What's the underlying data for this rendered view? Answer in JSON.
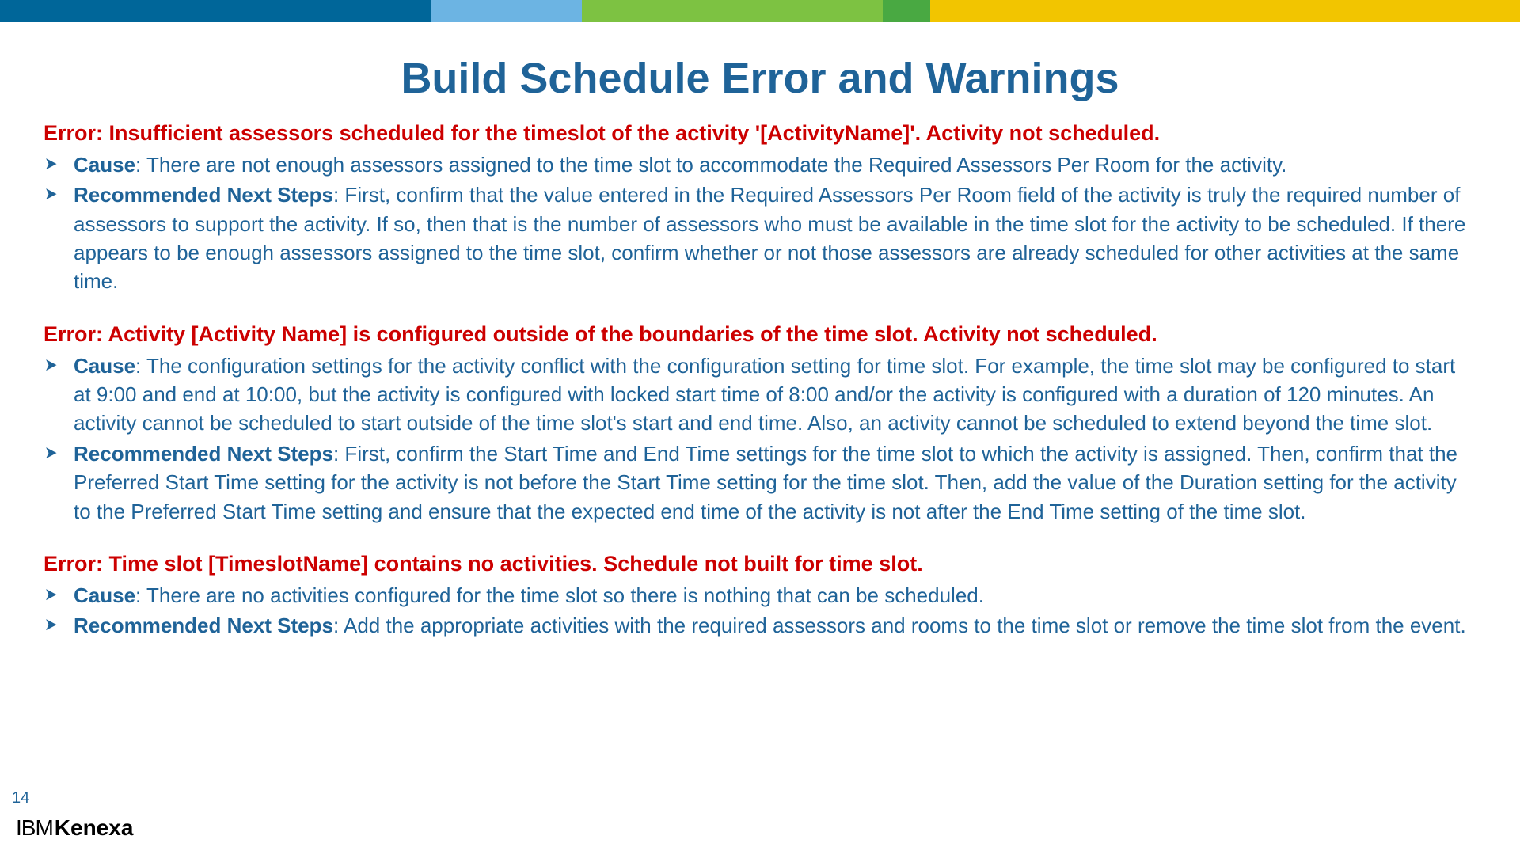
{
  "title": "Build Schedule Error and Warnings",
  "errors": [
    {
      "heading": "Error: Insufficient assessors scheduled for the timeslot of the activity '[ActivityName]'. Activity not scheduled.",
      "cause_label": "Cause",
      "cause_text": ": There are not enough assessors assigned to the time slot to accommodate the Required Assessors Per Room for the activity.",
      "steps_label": "Recommended Next Steps",
      "steps_text": ": First, confirm that the value entered in the Required Assessors Per Room field of the activity is truly the required number of assessors to support the activity. If so, then that is the number of assessors who must be available in the time slot for the activity to be scheduled. If there appears to be enough assessors assigned to the time slot, confirm whether or not those assessors are already scheduled for other activities at the same time."
    },
    {
      "heading": "Error: Activity [Activity Name] is configured outside of the boundaries of the time slot. Activity not scheduled.",
      "cause_label": "Cause",
      "cause_text": ": The configuration settings for the activity conflict with the configuration setting for time slot. For example, the time slot may be configured to start at 9:00 and end at 10:00, but the activity is configured with locked start time of 8:00 and/or the activity is configured with a duration of 120 minutes. An activity cannot be scheduled to start outside of the time slot's start and end time. Also, an activity cannot be scheduled to extend beyond the time slot.",
      "steps_label": "Recommended Next Steps",
      "steps_text": ": First, confirm the Start Time and End Time settings for the time slot to which the activity is assigned. Then, confirm that the Preferred Start Time setting for the activity is not before the Start Time setting for the time slot. Then, add the value of the Duration setting for the activity to the Preferred Start Time setting and ensure that the expected end time of the activity is not after the End Time setting of the time slot."
    },
    {
      "heading": "Error: Time slot [TimeslotName] contains no activities. Schedule not built for time slot.",
      "cause_label": "Cause",
      "cause_text": ": There are no activities configured for the time slot so there is nothing that can be scheduled.",
      "steps_label": "Recommended Next Steps",
      "steps_text": ": Add the appropriate activities with the required assessors and rooms to the time slot or remove the time slot from the event."
    }
  ],
  "page_number": "14",
  "logo_ibm": "IBM",
  "logo_kenexa": "Kenexa"
}
